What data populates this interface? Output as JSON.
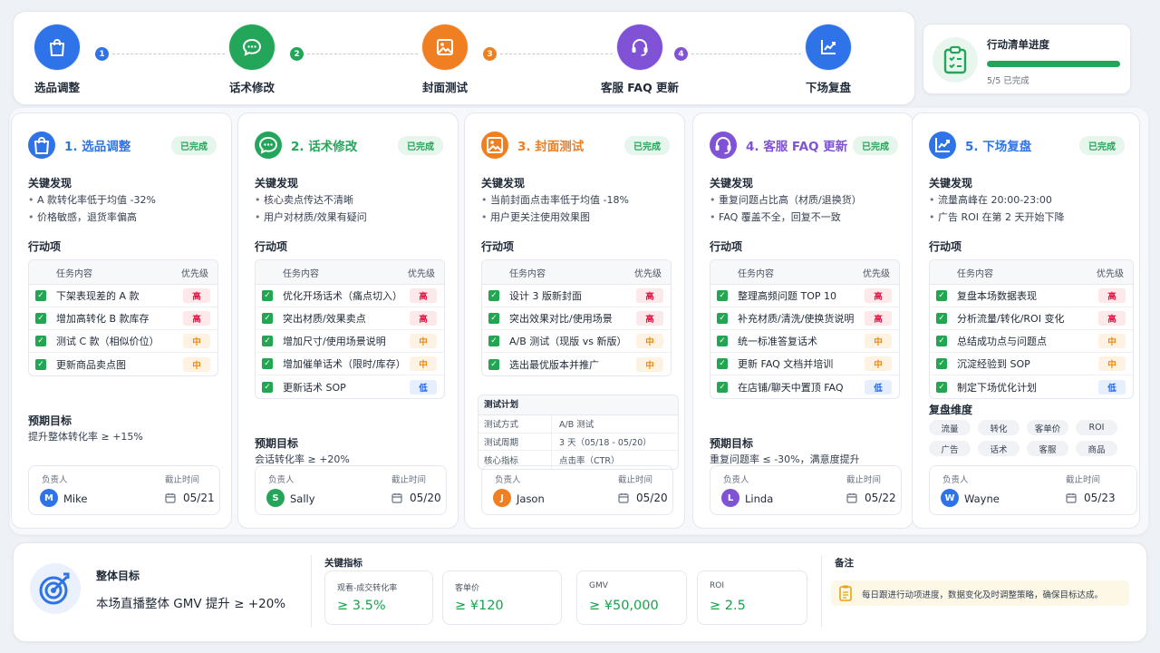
{
  "steps": [
    {
      "num": "1",
      "label": "选品调整",
      "color": "#2f73e8",
      "icon": "shopping-bag-icon"
    },
    {
      "num": "2",
      "label": "话术修改",
      "color": "#23a55a",
      "icon": "chat-bubble-icon"
    },
    {
      "num": "3",
      "label": "封面测试",
      "color": "#f07f22",
      "icon": "image-icon"
    },
    {
      "num": "4",
      "label": "客服 FAQ 更新",
      "color": "#7f52d6",
      "icon": "headset-icon"
    },
    {
      "num": "",
      "label": "下场复盘",
      "color": "#2f73e8",
      "icon": "chart-icon"
    }
  ],
  "progress": {
    "title": "行动清单进度",
    "value_text": "5/5 已完成",
    "fraction": 1.0,
    "icon": "clipboard-check-icon"
  },
  "labels": {
    "findings": "关键发现",
    "actions": "行动项",
    "goal": "预期目标",
    "task_col": "任务内容",
    "pri_col": "优先级",
    "owner": "负责人",
    "deadline": "截止时间",
    "done": "已完成"
  },
  "cards": [
    {
      "title": "1. 选品调整",
      "color": "#2f73e8",
      "icon": "shopping-bag-icon",
      "findings": [
        "A 款转化率低于均值 -32%",
        "价格敏感，退货率偏高"
      ],
      "tasks": [
        [
          "下架表现差的 A 款",
          "高"
        ],
        [
          "增加高转化 B 款库存",
          "高"
        ],
        [
          "测试 C 款（相似价位）",
          "中"
        ],
        [
          "更新商品卖点图",
          "中"
        ]
      ],
      "goal": "提升整体转化率 ≥ +15%",
      "owner": "Mike",
      "avatar": "M",
      "avatar_color": "#2f73e8",
      "deadline": "05/21"
    },
    {
      "title": "2. 话术修改",
      "color": "#23a55a",
      "icon": "chat-bubble-icon",
      "findings": [
        "核心卖点传达不清晰",
        "用户对材质/效果有疑问"
      ],
      "tasks": [
        [
          "优化开场话术（痛点切入）",
          "高"
        ],
        [
          "突出材质/效果卖点",
          "高"
        ],
        [
          "增加尺寸/使用场景说明",
          "中"
        ],
        [
          "增加催单话术（限时/库存）",
          "中"
        ],
        [
          "更新话术 SOP",
          "低"
        ]
      ],
      "goal": "会话转化率 ≥ +20%",
      "owner": "Sally",
      "avatar": "S",
      "avatar_color": "#23a55a",
      "deadline": "05/20"
    },
    {
      "title": "3. 封面测试",
      "color": "#f07f22",
      "icon": "image-icon",
      "findings": [
        "当前封面点击率低于均值 -18%",
        "用户更关注使用效果图"
      ],
      "tasks": [
        [
          "设计 3 版新封面",
          "高"
        ],
        [
          "突出效果对比/使用场景",
          "高"
        ],
        [
          "A/B 测试（现版 vs 新版）",
          "中"
        ],
        [
          "选出最优版本并推广",
          "中"
        ]
      ],
      "plan": {
        "title": "测试计划",
        "rows": [
          [
            "测试方式",
            "A/B 测试"
          ],
          [
            "测试周期",
            "3 天（05/18 - 05/20）"
          ],
          [
            "核心指标",
            "点击率（CTR）"
          ]
        ]
      },
      "owner": "Jason",
      "avatar": "J",
      "avatar_color": "#f07f22",
      "deadline": "05/20"
    },
    {
      "title": "4. 客服 FAQ 更新",
      "color": "#7f52d6",
      "icon": "headset-icon",
      "findings": [
        "重复问题占比高（材质/退换货）",
        "FAQ 覆盖不全，回复不一致"
      ],
      "tasks": [
        [
          "整理高频问题 TOP 10",
          "高"
        ],
        [
          "补充材质/清洗/使换货说明",
          "高"
        ],
        [
          "统一标准答复话术",
          "中"
        ],
        [
          "更新 FAQ 文档并培训",
          "中"
        ],
        [
          "在店铺/聊天中置顶 FAQ",
          "低"
        ]
      ],
      "goal": "重复问题率 ≤ -30%，满意度提升",
      "owner": "Linda",
      "avatar": "L",
      "avatar_color": "#7f52d6",
      "deadline": "05/22"
    },
    {
      "title": "5. 下场复盘",
      "color": "#2f73e8",
      "icon": "chart-icon",
      "findings": [
        "流量高峰在 20:00-23:00",
        "广告 ROI 在第 2 天开始下降"
      ],
      "tasks": [
        [
          "复盘本场数据表现",
          "高"
        ],
        [
          "分析流量/转化/ROI 变化",
          "高"
        ],
        [
          "总结成功点与问题点",
          "中"
        ],
        [
          "沉淀经验到 SOP",
          "中"
        ],
        [
          "制定下场优化计划",
          "低"
        ]
      ],
      "dims_title": "复盘维度",
      "dims": [
        "流量",
        "转化",
        "客单价",
        "ROI",
        "广告",
        "话术",
        "客服",
        "商品"
      ],
      "owner": "Wayne",
      "avatar": "W",
      "avatar_color": "#2f73e8",
      "deadline": "05/23"
    }
  ],
  "overall": {
    "title": "整体目标",
    "text": "本场直播整体 GMV 提升 ≥ +20%",
    "icon": "target-icon"
  },
  "metrics": {
    "title": "关键指标",
    "items": [
      [
        "观看-成交转化率",
        "≥ 3.5%"
      ],
      [
        "客单价",
        "≥ ¥120"
      ],
      [
        "GMV",
        "≥ ¥50,000"
      ],
      [
        "ROI",
        "≥ 2.5"
      ]
    ]
  },
  "notes": {
    "title": "备注",
    "text": "每日跟进行动项进度，数据变化及时调整策略，确保目标达成。",
    "icon": "note-icon"
  }
}
